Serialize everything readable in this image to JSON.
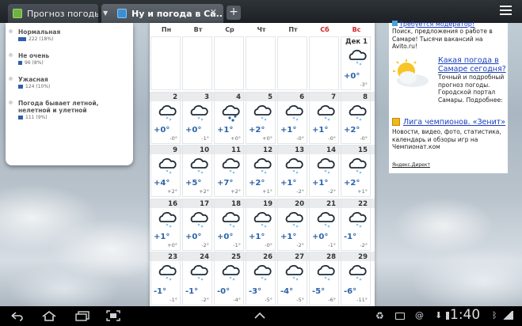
{
  "browser": {
    "tabs": [
      {
        "label": "Прогноз погоды н..."
      },
      {
        "label": "Ну и погода в Са..."
      }
    ],
    "new_tab_label": "+"
  },
  "poll": {
    "items": [
      {
        "label": "Нормальная",
        "count": "222 (18%)",
        "fraction": 0.18
      },
      {
        "label": "Не очень",
        "count": "96 (8%)",
        "fraction": 0.08
      },
      {
        "label": "Ужасная",
        "count": "124 (10%)",
        "fraction": 0.1
      },
      {
        "label": "Погода бывает летной, нелетной и улетной",
        "count": "111 (9%)",
        "fraction": 0.09
      }
    ]
  },
  "calendar": {
    "weekdays": [
      "Пн",
      "Вт",
      "Ср",
      "Чт",
      "Пт",
      "Сб",
      "Вс"
    ],
    "first_cell": {
      "day": "Дек  1",
      "temp": "+0°",
      "night": "-3°"
    },
    "weeks": [
      [
        {
          "d": "2",
          "t": "+0°",
          "n": "-0°"
        },
        {
          "d": "3",
          "t": "+0°",
          "n": "-1°"
        },
        {
          "d": "4",
          "t": "+1°",
          "n": "+0°"
        },
        {
          "d": "5",
          "t": "+2°",
          "n": "+0°"
        },
        {
          "d": "6",
          "t": "+1°",
          "n": "-0°"
        },
        {
          "d": "7",
          "t": "+1°",
          "n": "-0°"
        },
        {
          "d": "8",
          "t": "+2°",
          "n": "-0°"
        }
      ],
      [
        {
          "d": "9",
          "t": "+4°",
          "n": "+2°"
        },
        {
          "d": "10",
          "t": "+5°",
          "n": "+2°"
        },
        {
          "d": "11",
          "t": "+7°",
          "n": "+2°"
        },
        {
          "d": "12",
          "t": "+2°",
          "n": "+1°"
        },
        {
          "d": "13",
          "t": "+1°",
          "n": "-2°"
        },
        {
          "d": "14",
          "t": "+1°",
          "n": "-2°"
        },
        {
          "d": "15",
          "t": "+2°",
          "n": "+1°"
        }
      ],
      [
        {
          "d": "16",
          "t": "+1°",
          "n": "+0°"
        },
        {
          "d": "17",
          "t": "+0°",
          "n": "-2°"
        },
        {
          "d": "18",
          "t": "+0°",
          "n": "-1°"
        },
        {
          "d": "19",
          "t": "+1°",
          "n": "-0°"
        },
        {
          "d": "20",
          "t": "+1°",
          "n": "-2°"
        },
        {
          "d": "21",
          "t": "+0°",
          "n": "-1°"
        },
        {
          "d": "22",
          "t": "-1°",
          "n": "-2°"
        }
      ],
      [
        {
          "d": "23",
          "t": "-1°",
          "n": "-1°"
        },
        {
          "d": "24",
          "t": "-1°",
          "n": "-2°"
        },
        {
          "d": "25",
          "t": "-0°",
          "n": "-4°"
        },
        {
          "d": "26",
          "t": "-3°",
          "n": "-5°"
        },
        {
          "d": "27",
          "t": "-4°",
          "n": "-5°"
        },
        {
          "d": "28",
          "t": "-5°",
          "n": "-6°"
        },
        {
          "d": "29",
          "t": "-6°",
          "n": "-11°"
        }
      ]
    ]
  },
  "ad": {
    "item1_title": "Требуется модератор!",
    "item1_text": "Поиск, предложения о работе в Самаре! Тысячи вакансий на Avito.ru!",
    "item2_title": "Какая погода в Самаре сегодня?",
    "item2_text": "Точный и подробный прогноз погоды. Городской портал Самары. Подробнее:",
    "item3_title": "Лига чемпионов. «Зенит»",
    "item3_text": "Новости, видео, фото, статистика, календарь и обзоры игр на Чемпионат.ком",
    "footer": "Яндекс.Директ"
  },
  "system": {
    "clock": "1:40"
  }
}
